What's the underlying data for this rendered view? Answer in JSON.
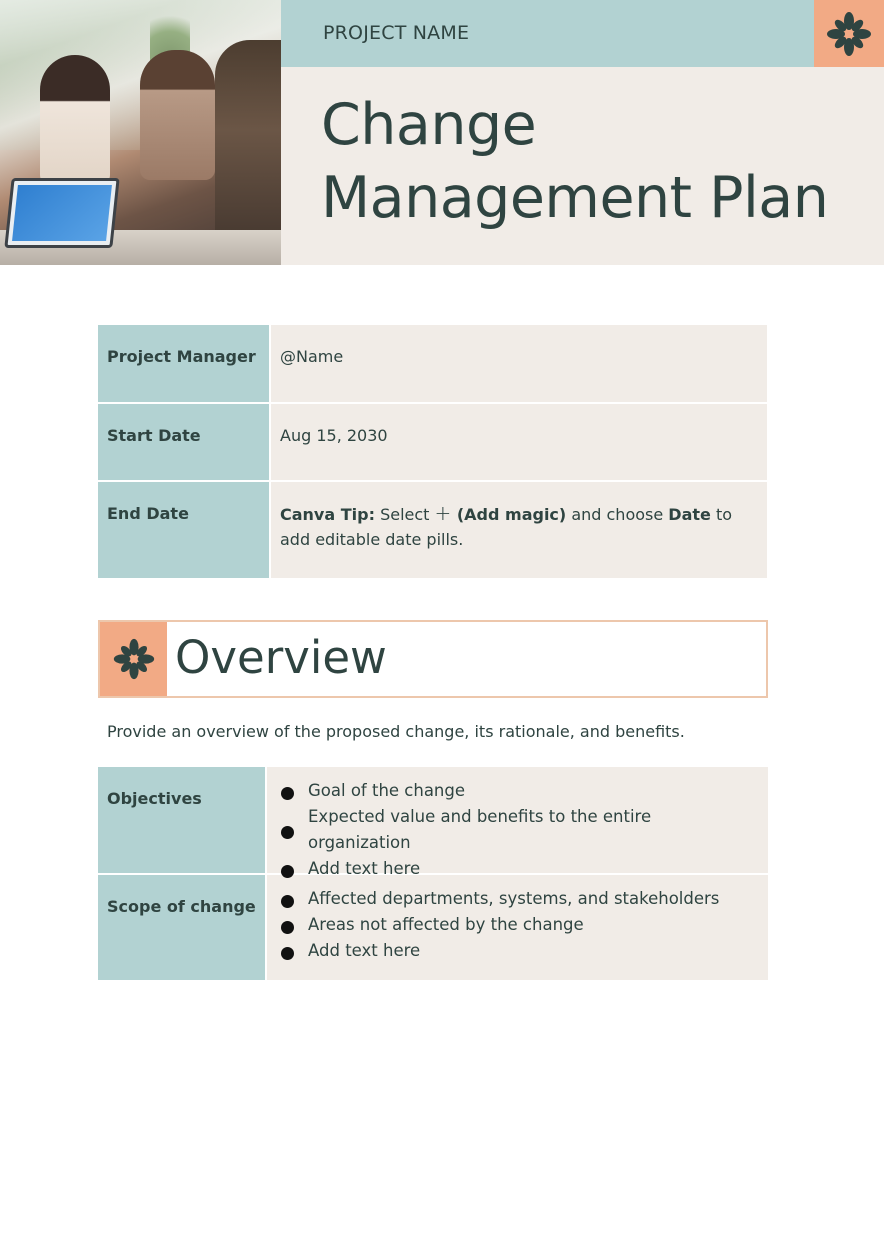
{
  "header": {
    "project_name": "PROJECT NAME",
    "title_line1": "Change",
    "title_line2": "Management Plan",
    "photo_description": "team-meeting-photo",
    "icon": "flower-icon"
  },
  "info": {
    "rows": [
      {
        "label": "Project Manager",
        "value": "@Name"
      },
      {
        "label": "Start Date",
        "value": "Aug 15, 2030"
      },
      {
        "label": "End Date",
        "tip": {
          "prefix_bold": "Canva Tip:",
          "text1": " Select ",
          "plus": "+",
          "add_magic_bold": " (Add magic)",
          "text2": " and choose ",
          "date_bold": "Date",
          "text3": " to add editable date pills."
        }
      }
    ]
  },
  "overview": {
    "title": "Overview",
    "icon": "flower-icon",
    "description": "Provide an overview of the proposed change, its rationale, and benefits.",
    "rows": [
      {
        "label": "Objectives",
        "items": [
          "Goal of the change",
          "Expected value and benefits to the entire organization",
          "Add text here"
        ]
      },
      {
        "label": "Scope of change",
        "items": [
          "Affected departments, systems, and stakeholders",
          "Areas not affected by the change",
          "Add text here"
        ]
      }
    ]
  },
  "colors": {
    "teal": "#b2d2d2",
    "beige": "#f1ece7",
    "peach": "#f2aa85",
    "text": "#2f4441"
  }
}
